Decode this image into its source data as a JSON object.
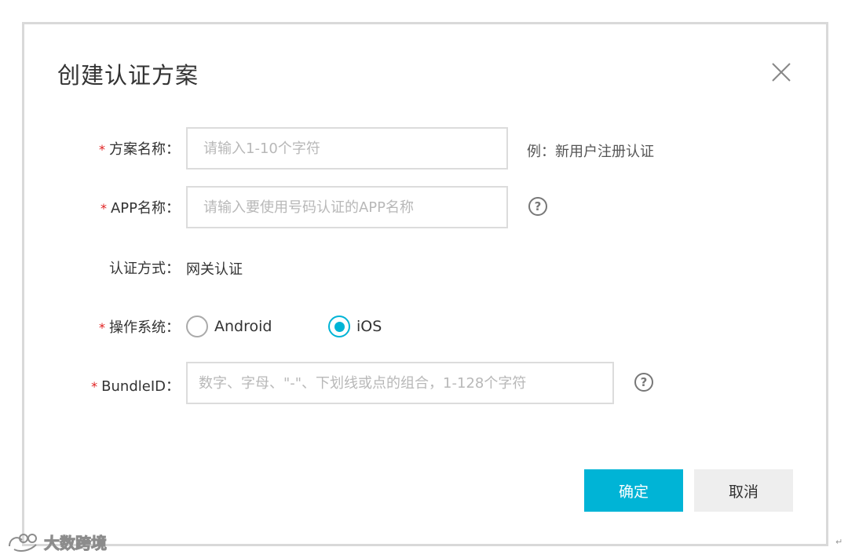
{
  "dialog": {
    "title": "创建认证方案",
    "close_icon": "close-icon"
  },
  "form": {
    "required_mark": "*",
    "scheme_name": {
      "label": "方案名称：",
      "placeholder": "请输入1-10个字符",
      "value": "",
      "example": "例：新用户注册认证"
    },
    "app_name": {
      "label": "APP名称：",
      "placeholder": "请输入要使用号码认证的APP名称",
      "value": "",
      "help_icon": "question-circle-icon",
      "help_glyph": "?"
    },
    "auth_method": {
      "label": "认证方式：",
      "value": "网关认证"
    },
    "os": {
      "label": "操作系统：",
      "options": [
        {
          "label": "Android",
          "selected": false
        },
        {
          "label": "iOS",
          "selected": true
        }
      ]
    },
    "bundle_id": {
      "label": "BundleID：",
      "placeholder": "数字、字母、\"-\"、下划线或点的组合，1-128个字符",
      "value": "",
      "help_icon": "question-circle-icon",
      "help_glyph": "?"
    }
  },
  "footer": {
    "confirm_label": "确定",
    "cancel_label": "取消"
  },
  "watermark": {
    "text": "大数跨境",
    "logo_icon": "brand-logo-icon"
  },
  "colors": {
    "accent": "#00b4d6",
    "required": "#e02020",
    "cancel_bg": "#eeeeee",
    "border": "#dcdcdc"
  }
}
